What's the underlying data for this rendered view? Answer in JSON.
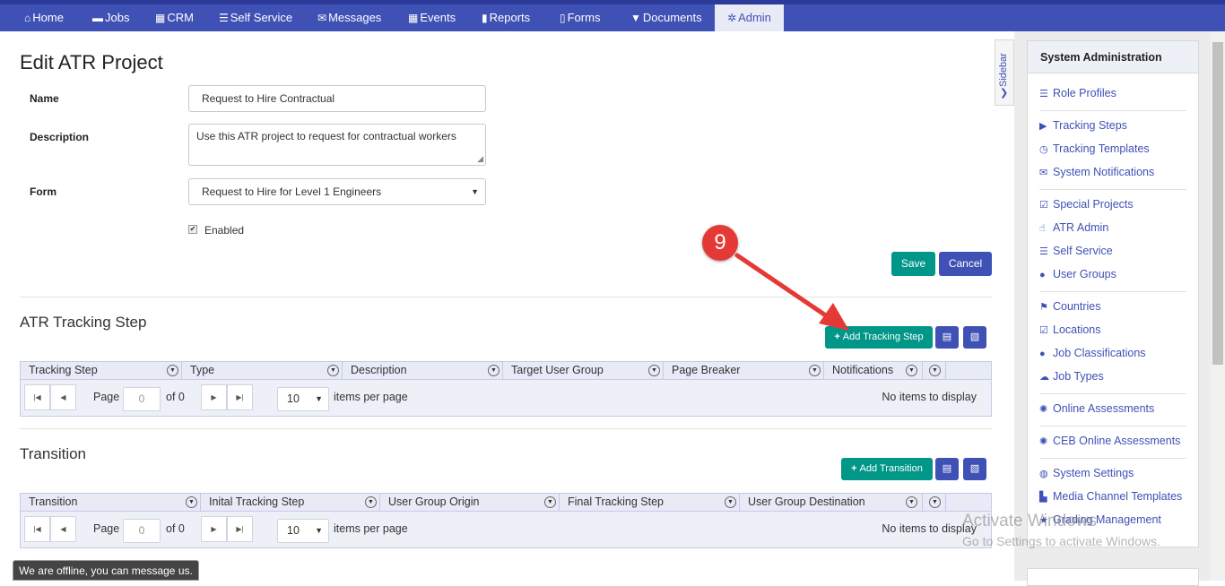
{
  "nav": {
    "items": [
      {
        "icon": "home-icon",
        "glyph": "⌂",
        "label": "Home"
      },
      {
        "icon": "folder-icon",
        "glyph": "▬",
        "label": "Jobs"
      },
      {
        "icon": "building-icon",
        "glyph": "▦",
        "label": "CRM"
      },
      {
        "icon": "list-icon",
        "glyph": "☰",
        "label": "Self Service"
      },
      {
        "icon": "envelope-icon",
        "glyph": "✉",
        "label": "Messages"
      },
      {
        "icon": "calendar-icon",
        "glyph": "▦",
        "label": "Events"
      },
      {
        "icon": "book-icon",
        "glyph": "▮",
        "label": "Reports"
      },
      {
        "icon": "file-icon",
        "glyph": "▯",
        "label": "Forms"
      },
      {
        "icon": "filter-icon",
        "glyph": "▼",
        "label": "Documents"
      },
      {
        "icon": "gear-icon",
        "glyph": "✲",
        "label": "Admin"
      }
    ]
  },
  "form": {
    "title": "Edit ATR Project",
    "name_label": "Name",
    "name_value": "Request to Hire Contractual",
    "description_label": "Description",
    "description_value": "Use this ATR project to request for contractual workers",
    "form_label": "Form",
    "form_value": "Request to Hire for Level 1 Engineers",
    "enabled_label": "Enabled",
    "save_label": "Save",
    "cancel_label": "Cancel"
  },
  "annotation": {
    "step_number": "9",
    "color": "#e53935"
  },
  "tracking": {
    "title": "ATR Tracking Step",
    "add_label": "Add Tracking Step",
    "columns": [
      "Tracking Step",
      "Type",
      "Description",
      "Target User Group",
      "Page Breaker",
      "Notifications"
    ],
    "pager": {
      "page_label": "Page",
      "page_value": "0",
      "of_label": "of 0",
      "page_size": "10",
      "per_page_label": "items per page",
      "empty_label": "No items to display"
    }
  },
  "transition": {
    "title": "Transition",
    "add_label": "Add Transition",
    "columns": [
      "Transition",
      "Inital Tracking Step",
      "User Group Origin",
      "Final Tracking Step",
      "User Group Destination"
    ],
    "pager": {
      "page_label": "Page",
      "page_value": "0",
      "of_label": "of 0",
      "page_size": "10",
      "per_page_label": "items per page",
      "empty_label": "No items to display"
    }
  },
  "sidebar": {
    "toggle_label": "Sidebar",
    "title": "System Administration",
    "groups": [
      [
        {
          "icon": "list-icon",
          "glyph": "☰",
          "label": "Role Profiles"
        }
      ],
      [
        {
          "icon": "step-icon",
          "glyph": "▶",
          "label": "Tracking Steps"
        },
        {
          "icon": "clock-icon",
          "glyph": "◷",
          "label": "Tracking Templates"
        },
        {
          "icon": "envelope-icon",
          "glyph": "✉",
          "label": "System Notifications"
        }
      ],
      [
        {
          "icon": "check-icon",
          "glyph": "☑",
          "label": "Special Projects"
        },
        {
          "icon": "thumbs-up-icon",
          "glyph": "☝",
          "label": "ATR Admin"
        },
        {
          "icon": "list-icon",
          "glyph": "☰",
          "label": "Self Service"
        },
        {
          "icon": "user-icon",
          "glyph": "●",
          "label": "User Groups"
        }
      ],
      [
        {
          "icon": "flag-icon",
          "glyph": "⚑",
          "label": "Countries"
        },
        {
          "icon": "check-icon",
          "glyph": "☑",
          "label": "Locations"
        },
        {
          "icon": "user-icon",
          "glyph": "●",
          "label": "Job Classifications"
        },
        {
          "icon": "cloud-icon",
          "glyph": "☁",
          "label": "Job Types"
        }
      ],
      [
        {
          "icon": "asterisk-icon",
          "glyph": "✺",
          "label": "Online Assessments"
        }
      ],
      [
        {
          "icon": "asterisk-icon",
          "glyph": "✺",
          "label": "CEB Online Assessments"
        }
      ],
      [
        {
          "icon": "globe-icon",
          "glyph": "◍",
          "label": "System Settings"
        },
        {
          "icon": "media-icon",
          "glyph": "▙",
          "label": "Media Channel Templates"
        },
        {
          "icon": "star-icon",
          "glyph": "★",
          "label": "Grading Management"
        }
      ]
    ]
  },
  "watermark": {
    "line1": "Activate Windows",
    "line2": "Go to Settings to activate Windows."
  },
  "chat": {
    "offline_label": "We are offline, you can message us."
  }
}
